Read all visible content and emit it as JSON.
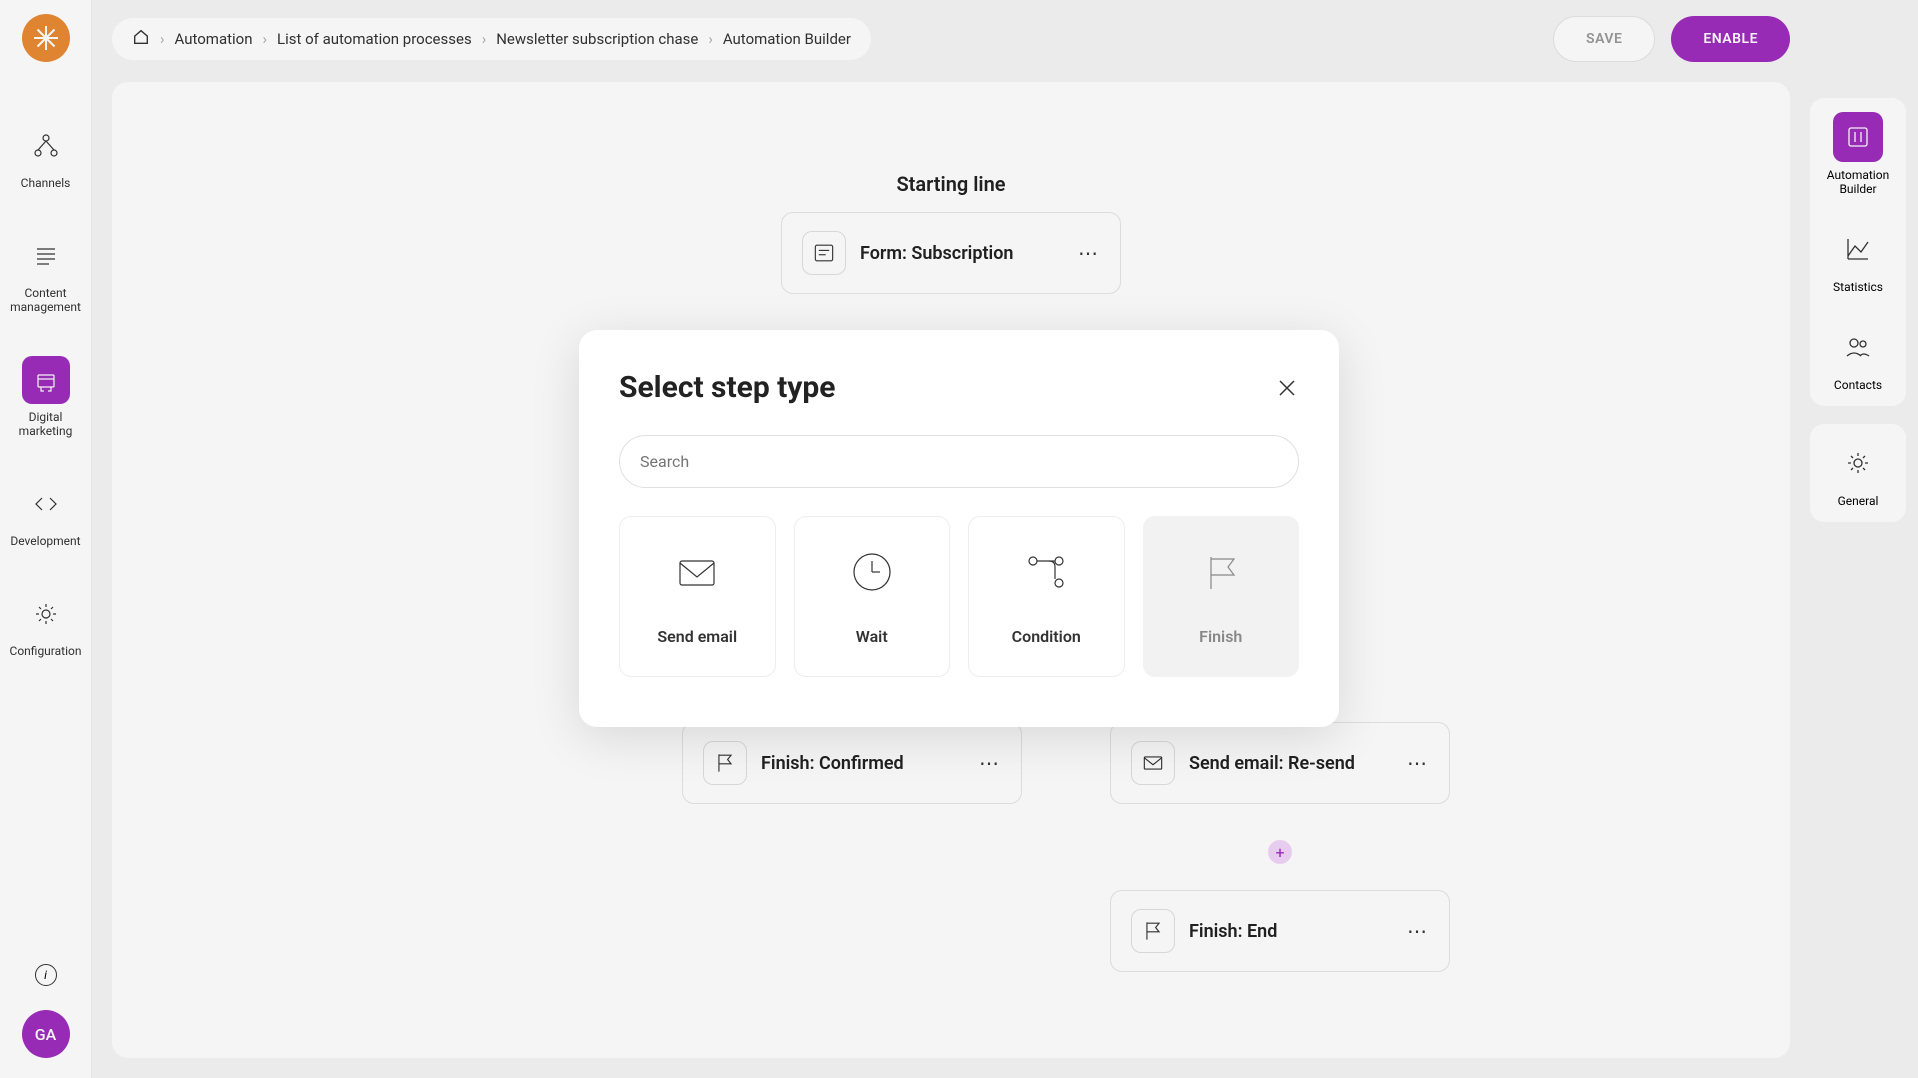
{
  "sidebar": {
    "items": [
      {
        "label": "Channels"
      },
      {
        "label": "Content management"
      },
      {
        "label": "Digital marketing"
      },
      {
        "label": "Development"
      },
      {
        "label": "Configuration"
      }
    ],
    "avatar": "GA"
  },
  "breadcrumb": {
    "items": [
      "Automation",
      "List of automation processes",
      "Newsletter subscription chase",
      "Automation Builder"
    ]
  },
  "top_actions": {
    "save": "SAVE",
    "enable": "ENABLE"
  },
  "canvas": {
    "starting_line": "Starting line",
    "nodes": {
      "form": "Form: Subscription",
      "finish_confirmed": "Finish: Confirmed",
      "send_email": "Send email: Re-send",
      "finish_end": "Finish: End"
    }
  },
  "right_panel": {
    "top": [
      {
        "label": "Automation Builder"
      },
      {
        "label": "Statistics"
      },
      {
        "label": "Contacts"
      }
    ],
    "bottom": [
      {
        "label": "General"
      }
    ]
  },
  "modal": {
    "title": "Select step type",
    "search_placeholder": "Search",
    "types": {
      "send_email": "Send email",
      "wait": "Wait",
      "condition": "Condition",
      "finish": "Finish"
    }
  }
}
